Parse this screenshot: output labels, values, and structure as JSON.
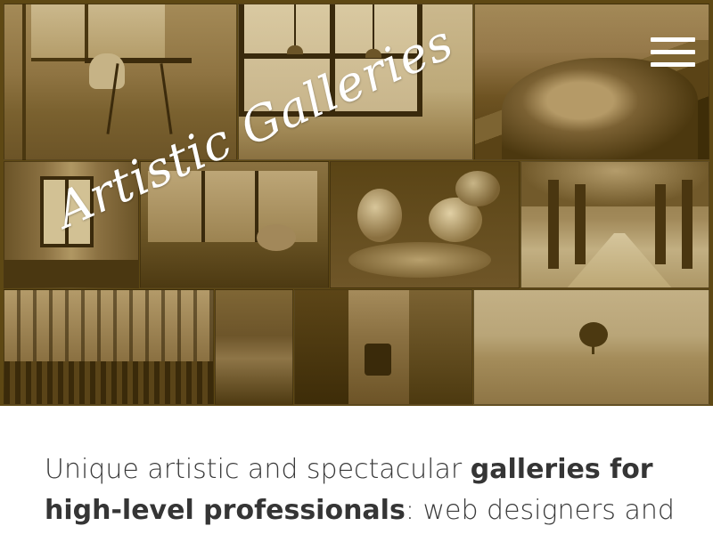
{
  "hero": {
    "title": "Artistic Galleries",
    "menu_icon": "hamburger-menu-icon",
    "tint_color": "#5e4814",
    "tiles": [
      {
        "name": "interior-dining-photo"
      },
      {
        "name": "interior-window-photo"
      },
      {
        "name": "mountains-photo"
      },
      {
        "name": "curtain-window-photo"
      },
      {
        "name": "cat-by-window-photo"
      },
      {
        "name": "pastries-photo"
      },
      {
        "name": "tree-lined-path-photo"
      },
      {
        "name": "city-street-crowd-photo"
      },
      {
        "name": "sea-photo"
      },
      {
        "name": "tram-street-photo"
      },
      {
        "name": "field-tree-photo"
      }
    ]
  },
  "intro": {
    "part1": "Unique artistic and spectacular ",
    "bold1": "galleries for high-level professionals",
    "part2": ": web designers and"
  }
}
